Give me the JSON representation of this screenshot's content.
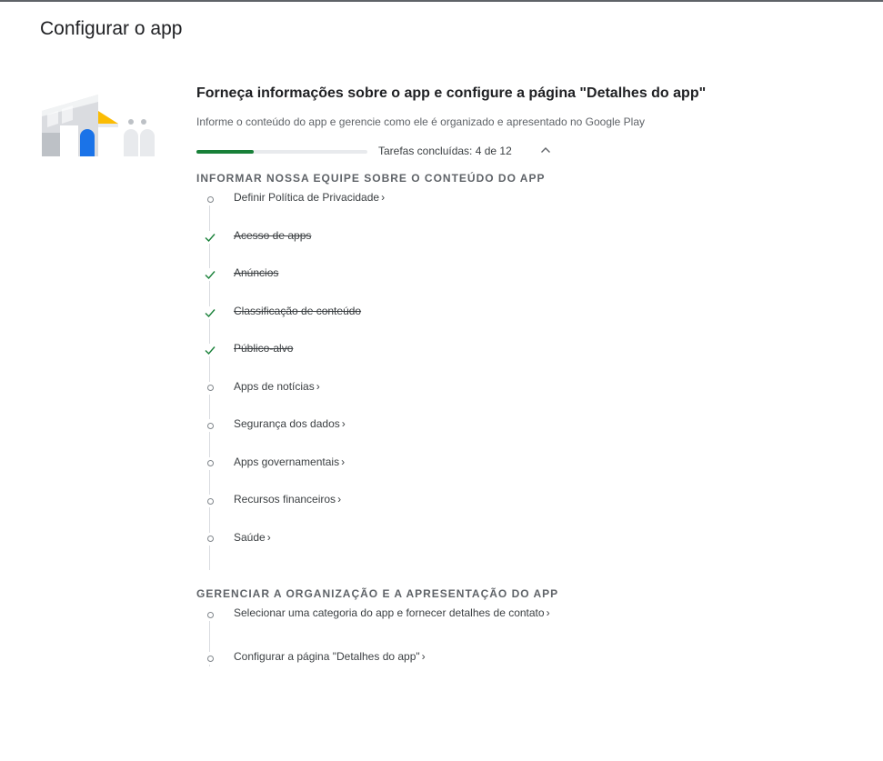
{
  "page": {
    "title": "Configurar o app"
  },
  "section": {
    "heading": "Forneça informações sobre o app e configure a página \"Detalhes do app\"",
    "subtitle": "Informe o conteúdo do app e gerencie como ele é organizado e apresentado no Google Play",
    "progress": {
      "text": "Tarefas concluídas: 4 de 12",
      "completed": 4,
      "total": 12,
      "fraction": 0.333,
      "bar_color": "#188038"
    }
  },
  "groups": [
    {
      "title": "INFORMAR NOSSA EQUIPE SOBRE O CONTEÚDO DO APP",
      "tasks": [
        {
          "label": "Definir Política de Privacidade",
          "done": false,
          "chevron": "›"
        },
        {
          "label": "Acesso de apps",
          "done": true,
          "chevron": ""
        },
        {
          "label": "Anúncios",
          "done": true,
          "chevron": ""
        },
        {
          "label": "Classificação de conteúdo",
          "done": true,
          "chevron": ""
        },
        {
          "label": "Público-alvo",
          "done": true,
          "chevron": ""
        },
        {
          "label": "Apps de notícias",
          "done": false,
          "chevron": "›"
        },
        {
          "label": "Segurança dos dados",
          "done": false,
          "chevron": "›"
        },
        {
          "label": "Apps governamentais",
          "done": false,
          "chevron": "›"
        },
        {
          "label": "Recursos financeiros",
          "done": false,
          "chevron": "›"
        },
        {
          "label": "Saúde",
          "done": false,
          "chevron": "›"
        }
      ]
    },
    {
      "title": "GERENCIAR A ORGANIZAÇÃO E A APRESENTAÇÃO DO APP",
      "tasks": [
        {
          "label": "Selecionar uma categoria do app e fornecer detalhes de contato",
          "done": false,
          "chevron": "›"
        },
        {
          "label": "Configurar a página \"Detalhes do app\"",
          "done": false,
          "chevron": "›"
        }
      ]
    }
  ],
  "icons": {
    "done": "check-icon",
    "pending": "circle-icon",
    "toggle": "chevron-up-icon"
  },
  "colors": {
    "check": "#188038",
    "accent_blue": "#1a73e8",
    "accent_yellow": "#fbbc04"
  }
}
